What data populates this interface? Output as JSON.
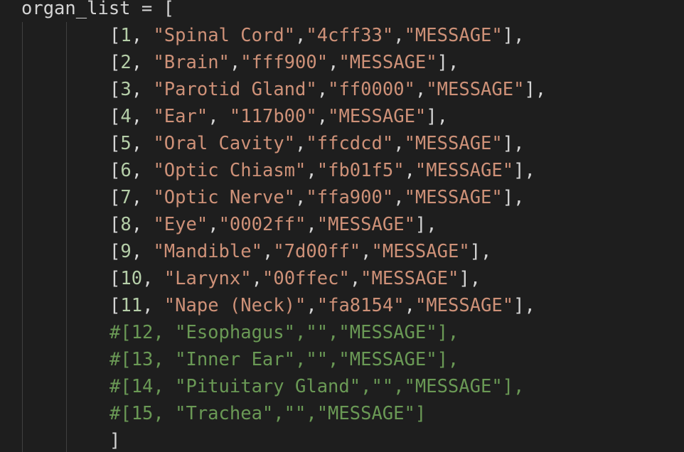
{
  "editor": {
    "first_line": {
      "variable": "organ_list",
      "operator": " = ",
      "open_bracket": "["
    },
    "entries": [
      {
        "id": "1",
        "name": "\"Spinal Cord\"",
        "color": "\"4cff33\"",
        "message": "\"MESSAGE\"",
        "spacing": " ",
        "color_sep": ",",
        "end": "],"
      },
      {
        "id": "2",
        "name": "\"Brain\"",
        "color": "\"fff900\"",
        "message": "\"MESSAGE\"",
        "spacing": " ",
        "color_sep": ",",
        "end": "],"
      },
      {
        "id": "3",
        "name": "\"Parotid Gland\"",
        "color": "\"ff0000\"",
        "message": "\"MESSAGE\"",
        "spacing": " ",
        "color_sep": ",",
        "end": "],"
      },
      {
        "id": "4",
        "name": "\"Ear\"",
        "color": "\"117b00\"",
        "message": "\"MESSAGE\"",
        "spacing": " ",
        "color_sep": ", ",
        "end": "],"
      },
      {
        "id": "5",
        "name": "\"Oral Cavity\"",
        "color": "\"ffcdcd\"",
        "message": "\"MESSAGE\"",
        "spacing": " ",
        "color_sep": ",",
        "end": "],"
      },
      {
        "id": "6",
        "name": "\"Optic Chiasm\"",
        "color": "\"fb01f5\"",
        "message": "\"MESSAGE\"",
        "spacing": " ",
        "color_sep": ",",
        "end": "],"
      },
      {
        "id": "7",
        "name": "\"Optic Nerve\"",
        "color": "\"ffa900\"",
        "message": "\"MESSAGE\"",
        "spacing": " ",
        "color_sep": ",",
        "end": "],"
      },
      {
        "id": "8",
        "name": "\"Eye\"",
        "color": "\"0002ff\"",
        "message": "\"MESSAGE\"",
        "spacing": " ",
        "color_sep": ",",
        "end": "],"
      },
      {
        "id": "9",
        "name": "\"Mandible\"",
        "color": "\"7d00ff\"",
        "message": "\"MESSAGE\"",
        "spacing": " ",
        "color_sep": ",",
        "end": "],"
      },
      {
        "id": "10",
        "name": "\"Larynx\"",
        "color": "\"00ffec\"",
        "message": "\"MESSAGE\"",
        "spacing": " ",
        "color_sep": ",",
        "end": "],"
      },
      {
        "id": "11",
        "name": "\"Nape (Neck)\"",
        "color": "\"fa8154\"",
        "message": "\"MESSAGE\"",
        "spacing": " ",
        "color_sep": ",",
        "end": "],"
      }
    ],
    "commented_entries": [
      "#[12, \"Esophagus\",\"\",\"MESSAGE\"],",
      "#[13, \"Inner Ear\",\"\",\"MESSAGE\"],",
      "#[14, \"Pituitary Gland\",\"\",\"MESSAGE\"],",
      "#[15, \"Trachea\",\"\",\"MESSAGE\"]"
    ],
    "closing_bracket": "]"
  },
  "theme": {
    "background": "#1e1e1e",
    "number_color": "#b5cea8",
    "string_color": "#ce9178",
    "comment_color": "#6a9955",
    "text_color": "#d4d4d4"
  }
}
